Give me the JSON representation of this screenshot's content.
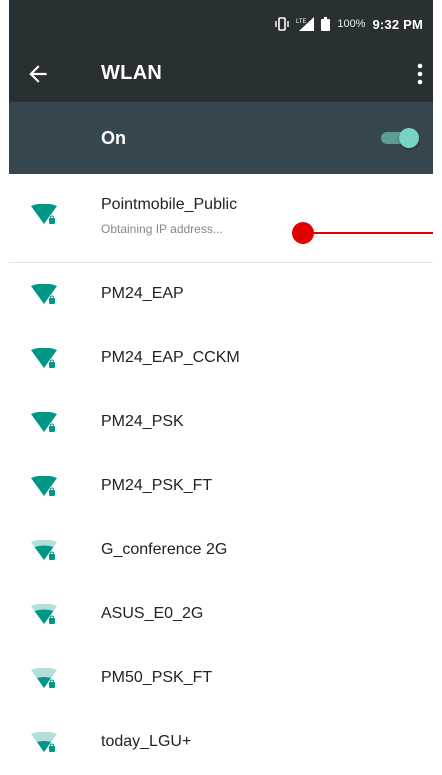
{
  "status_bar": {
    "battery_percent": "100%",
    "time": "9:32 PM",
    "icons": [
      "vibrate-icon",
      "signal-icon",
      "battery-icon"
    ]
  },
  "app_bar": {
    "title": "WLAN",
    "back_icon": "arrow-back-icon",
    "menu_icon": "more-vert-icon"
  },
  "wlan_toggle": {
    "label": "On",
    "state": true
  },
  "networks": [
    {
      "name": "Pointmobile_Public",
      "status": "Obtaining IP address...",
      "strength": "full"
    },
    {
      "name": "PM24_EAP",
      "strength": "full"
    },
    {
      "name": "PM24_EAP_CCKM",
      "strength": "full"
    },
    {
      "name": "PM24_PSK",
      "strength": "full"
    },
    {
      "name": "PM24_PSK_FT",
      "strength": "full"
    },
    {
      "name": "G_conference 2G",
      "strength": "partial"
    },
    {
      "name": "ASUS_E0_2G",
      "strength": "partial"
    },
    {
      "name": "PM50_PSK_FT",
      "strength": "weak"
    },
    {
      "name": "today_LGU+",
      "strength": "weak"
    }
  ],
  "colors": {
    "status_bar_bg": "#283033",
    "app_bar_bg": "#283033",
    "toggle_bar_bg": "#37474f",
    "wifi_full": "#009688",
    "wifi_faded": "#b2dfdb",
    "annotation": "#e00000"
  }
}
